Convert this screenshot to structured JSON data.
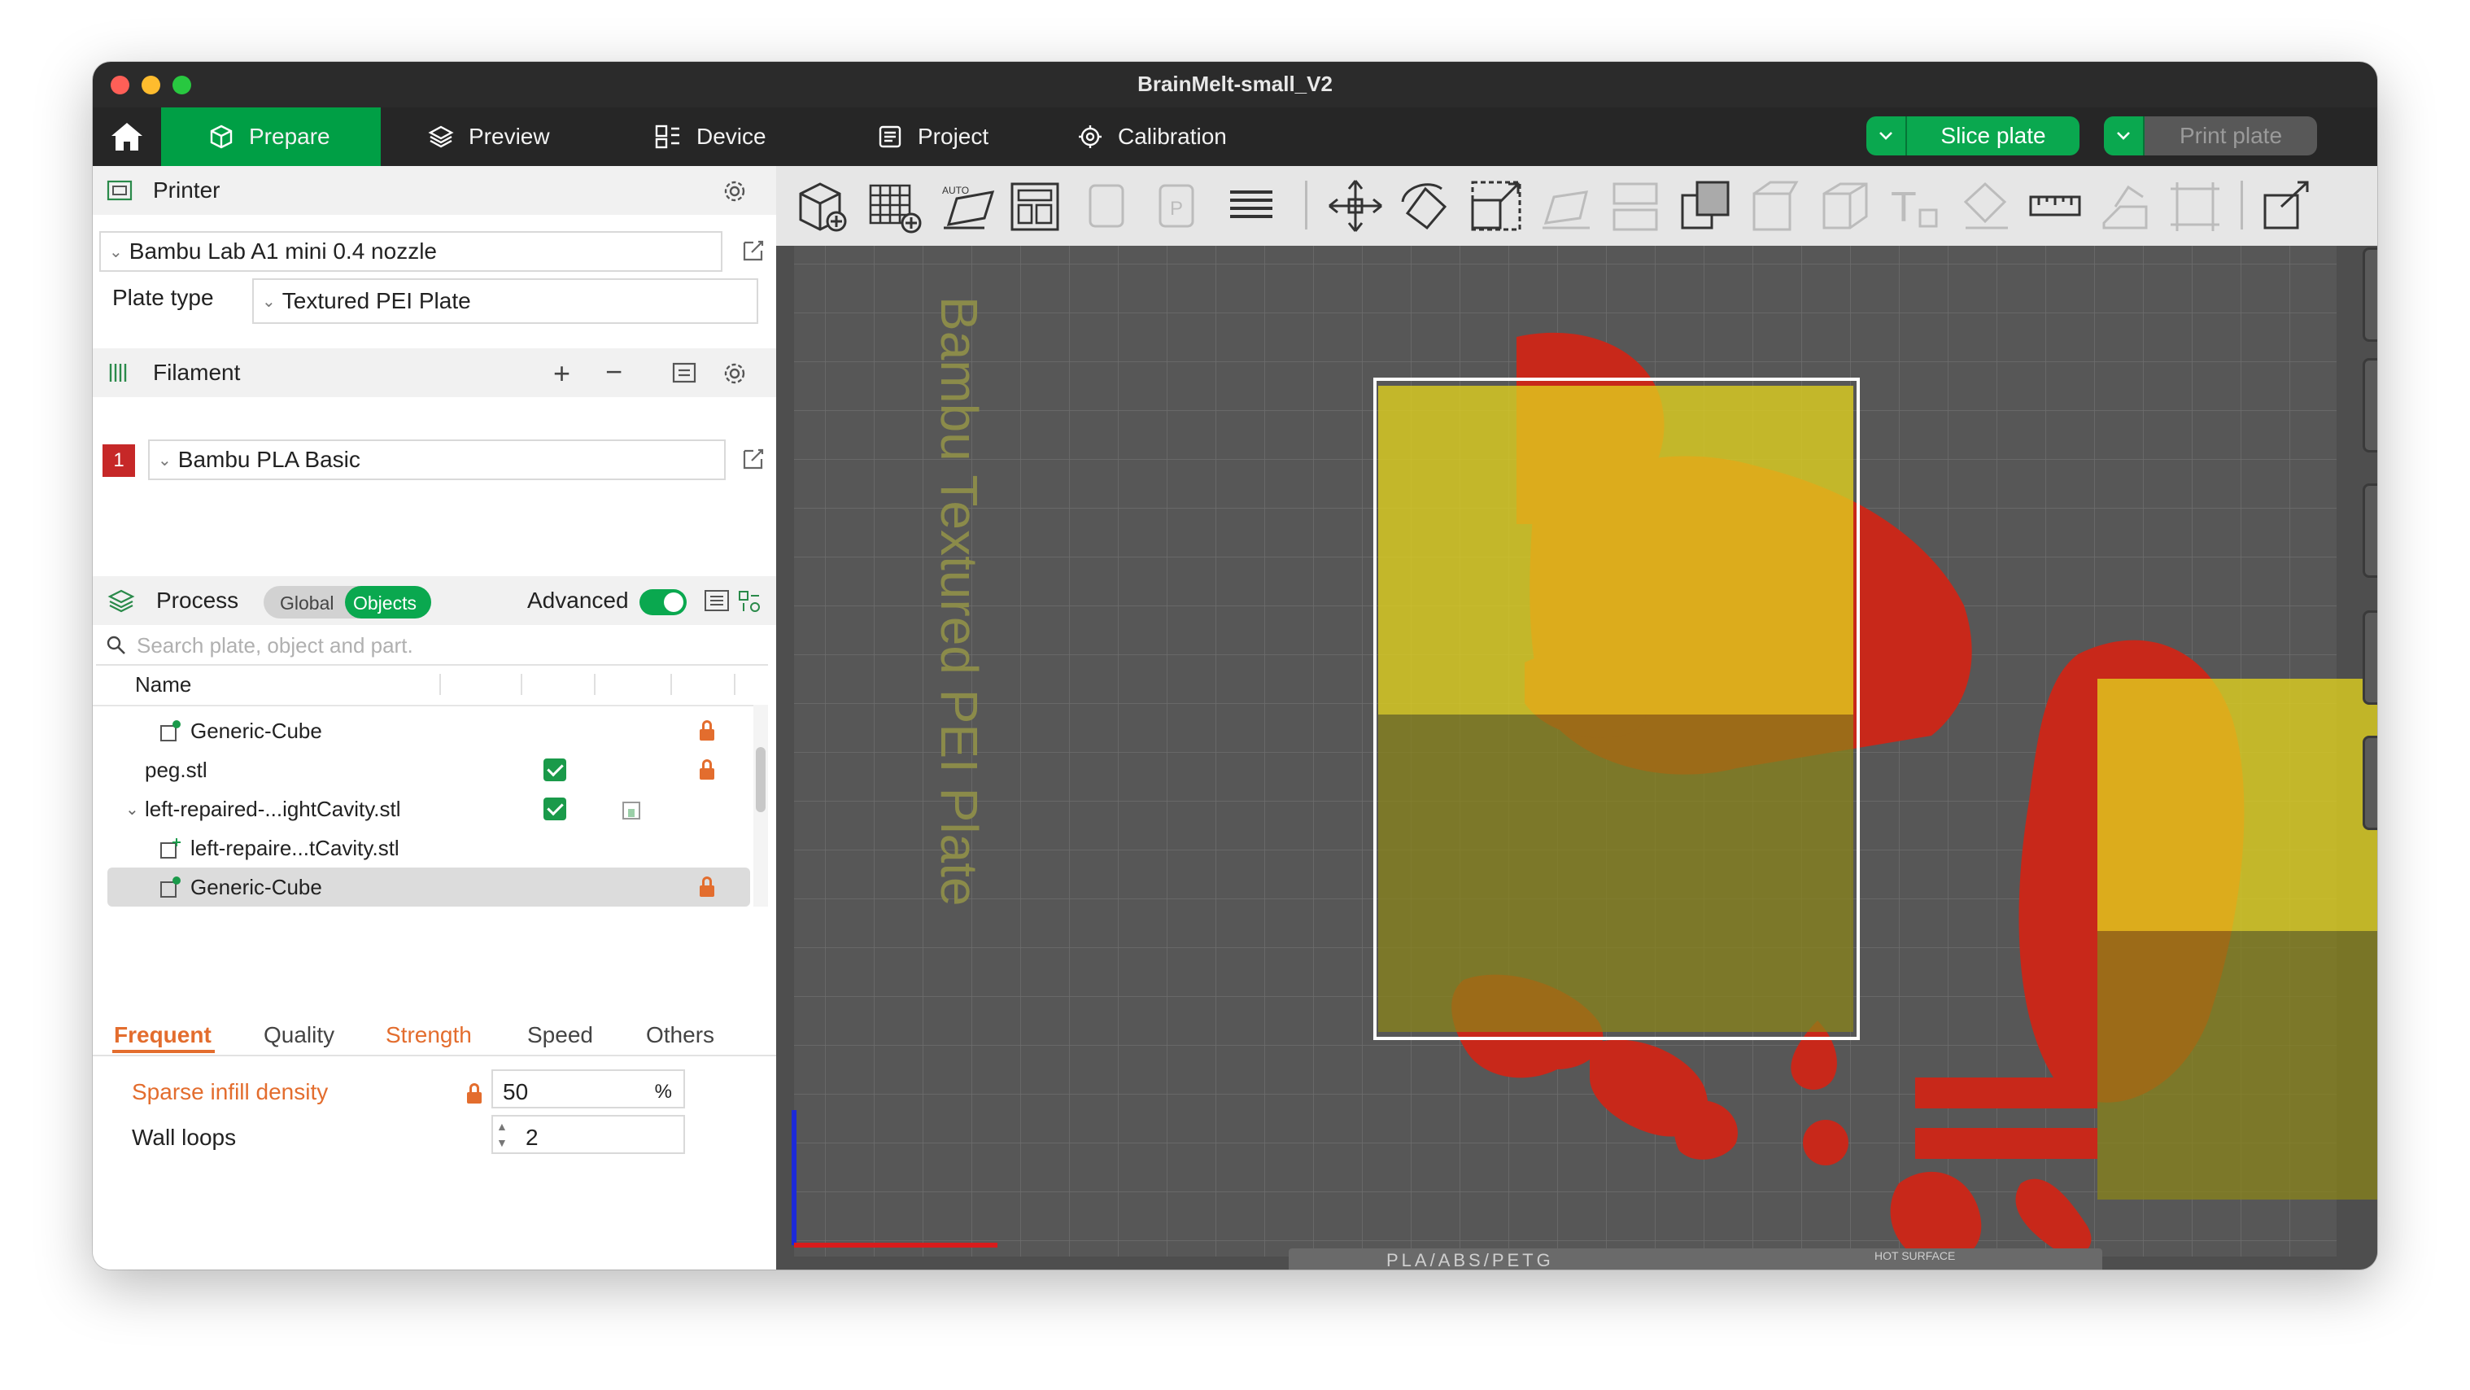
{
  "window": {
    "title": "BrainMelt-small_V2"
  },
  "tabs": [
    {
      "label": "Prepare",
      "active": true
    },
    {
      "label": "Preview",
      "active": false
    },
    {
      "label": "Device",
      "active": false
    },
    {
      "label": "Project",
      "active": false
    },
    {
      "label": "Calibration",
      "active": false
    }
  ],
  "actions": {
    "slice_label": "Slice plate",
    "print_label": "Print plate"
  },
  "printer": {
    "section_label": "Printer",
    "selected": "Bambu Lab A1 mini 0.4 nozzle",
    "plate_type_label": "Plate type",
    "plate_type": "Textured PEI Plate"
  },
  "filament": {
    "section_label": "Filament",
    "slot": "1",
    "selected": "Bambu PLA Basic",
    "slot_color": "#c62828"
  },
  "process": {
    "section_label": "Process",
    "toggle_global": "Global",
    "toggle_objects": "Objects",
    "advanced_label": "Advanced",
    "advanced_on": true
  },
  "object_list": {
    "search_placeholder": "Search plate, object and part.",
    "column_name": "Name",
    "rows": [
      {
        "name": "Generic-Cube",
        "level": 1,
        "checked": false,
        "locked": true,
        "selected": false
      },
      {
        "name": "peg.stl",
        "level": 0,
        "checked": true,
        "locked": true,
        "selected": false
      },
      {
        "name": "left-repaired-...ightCavity.stl",
        "level": 0,
        "checked": true,
        "locked": false,
        "selected": false
      },
      {
        "name": "left-repaire...tCavity.stl",
        "level": 1,
        "checked": false,
        "locked": false,
        "selected": false
      },
      {
        "name": "Generic-Cube",
        "level": 1,
        "checked": false,
        "locked": true,
        "selected": true
      }
    ]
  },
  "param_tabs": [
    {
      "label": "Frequent",
      "active": true,
      "accent": true
    },
    {
      "label": "Quality",
      "active": false,
      "accent": false
    },
    {
      "label": "Strength",
      "active": false,
      "accent": true
    },
    {
      "label": "Speed",
      "active": false,
      "accent": false
    },
    {
      "label": "Others",
      "active": false,
      "accent": false
    }
  ],
  "params": {
    "sparse_infill_label": "Sparse infill density",
    "sparse_infill_value": "50",
    "sparse_infill_unit": "%",
    "wall_loops_label": "Wall loops",
    "wall_loops_value": "2"
  },
  "viewport": {
    "plate_label": "Bambu Textured PEI Plate",
    "plate_bottom_label": "PLA/ABS/PETG",
    "hot_surface_label": "HOT SURFACE"
  },
  "colors": {
    "accent_green": "#009f45",
    "orange": "#e36d2e",
    "model_red": "#c8281a",
    "modifier_yellow": "#e1d21e"
  }
}
